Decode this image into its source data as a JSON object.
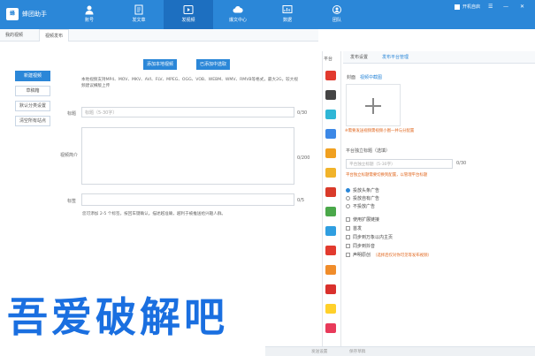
{
  "app": {
    "logo_text": "蜂",
    "name": "蜂团助手"
  },
  "nav": [
    {
      "label": "账号",
      "icon": "user-icon"
    },
    {
      "label": "发文章",
      "icon": "article-icon"
    },
    {
      "label": "发视频",
      "icon": "video-icon",
      "active": true
    },
    {
      "label": "爆文中心",
      "icon": "cloud-icon"
    },
    {
      "label": "数据",
      "icon": "chart-icon"
    },
    {
      "label": "团队",
      "icon": "team-icon"
    }
  ],
  "window": {
    "login_label": "开机自启",
    "menu": "☰",
    "minimize": "—",
    "close": "✕"
  },
  "tabs": [
    {
      "label": "我的视频"
    },
    {
      "label": "视频发布",
      "active": true
    }
  ],
  "sidebar": [
    {
      "label": "新建视频",
      "active": true
    },
    {
      "label": "草稿箱"
    },
    {
      "label": "默认分类设置"
    },
    {
      "label": "清空所有站点"
    }
  ],
  "buttons": {
    "add_local": "添加本地视频",
    "add_cloud": "已添加中选取"
  },
  "support_text": "本地视频支持MP4、MOV、MKV、AVI、FLV、MPEG、OGG、VOB、WEBM、WMV、RMVB等格式，最大2G，较大视频建议横版上传",
  "form": {
    "title_label": "标题",
    "title_placeholder": "标题（5-30字）",
    "title_count": "0/30",
    "intro_label": "视频简介",
    "intro_count": "0/200",
    "tags_label": "标签",
    "tags_count": "0/5",
    "hint": "您可添加 2-5 个标签，按回车键确认。描述越准确，越利于被推送给兴趣人群。"
  },
  "platform_header": "平台",
  "platforms": [
    {
      "name": "toutiao-icon",
      "color": "#e23a2e"
    },
    {
      "name": "baijia-icon",
      "color": "#444444"
    },
    {
      "name": "iqiyi-icon",
      "color": "#2fb6d6"
    },
    {
      "name": "yidian-icon",
      "color": "#3c88e6"
    },
    {
      "name": "dayu-icon",
      "color": "#f0a020"
    },
    {
      "name": "penguin-icon",
      "color": "#f1b32a"
    },
    {
      "name": "sohu-icon",
      "color": "#d93a2a"
    },
    {
      "name": "wangyi-icon",
      "color": "#4aa84a"
    },
    {
      "name": "qq-icon",
      "color": "#2f9ee0"
    },
    {
      "name": "weibo-icon",
      "color": "#e23a2e"
    },
    {
      "name": "bilibili-icon",
      "color": "#f08c2a"
    },
    {
      "name": "douyin-icon",
      "color": "#d9302c"
    },
    {
      "name": "kuaishou-icon",
      "color": "#ffd02a"
    },
    {
      "name": "xigua-icon",
      "color": "#e83a5a"
    }
  ],
  "right_panel": {
    "tabs": [
      {
        "label": "发布设置"
      },
      {
        "label": "发布平台管理",
        "link": true
      }
    ],
    "cover_label": "封面",
    "cover_link": "视频中截图",
    "cover_warning": "※需要发送视频需视频小图一并与分配置",
    "title_label": "平台独立标题（选填）",
    "title_placeholder": "平台独立标题（5-30字）",
    "title_count": "0/30",
    "title_warning": "平台独立标题需要切换到配置，以管理平台标题",
    "options": [
      {
        "type": "radio",
        "label": "投放头条广告",
        "checked": true
      },
      {
        "type": "radio",
        "label": "投放自有广告"
      },
      {
        "type": "radio",
        "label": "不投放广告"
      },
      {
        "type": "checkbox",
        "label": "使用扩展链接"
      },
      {
        "type": "checkbox",
        "label": "首发"
      },
      {
        "type": "checkbox",
        "label": "同步到万象以内主页"
      },
      {
        "type": "checkbox",
        "label": "同步到抖音"
      },
      {
        "type": "checkbox",
        "label": "声明原创",
        "warning": "（选择后仅对你可见等发布视频）"
      }
    ]
  },
  "bottom_bar": {
    "left": "发送设置",
    "right": "保存草稿"
  },
  "watermark": "吾爱破解吧"
}
